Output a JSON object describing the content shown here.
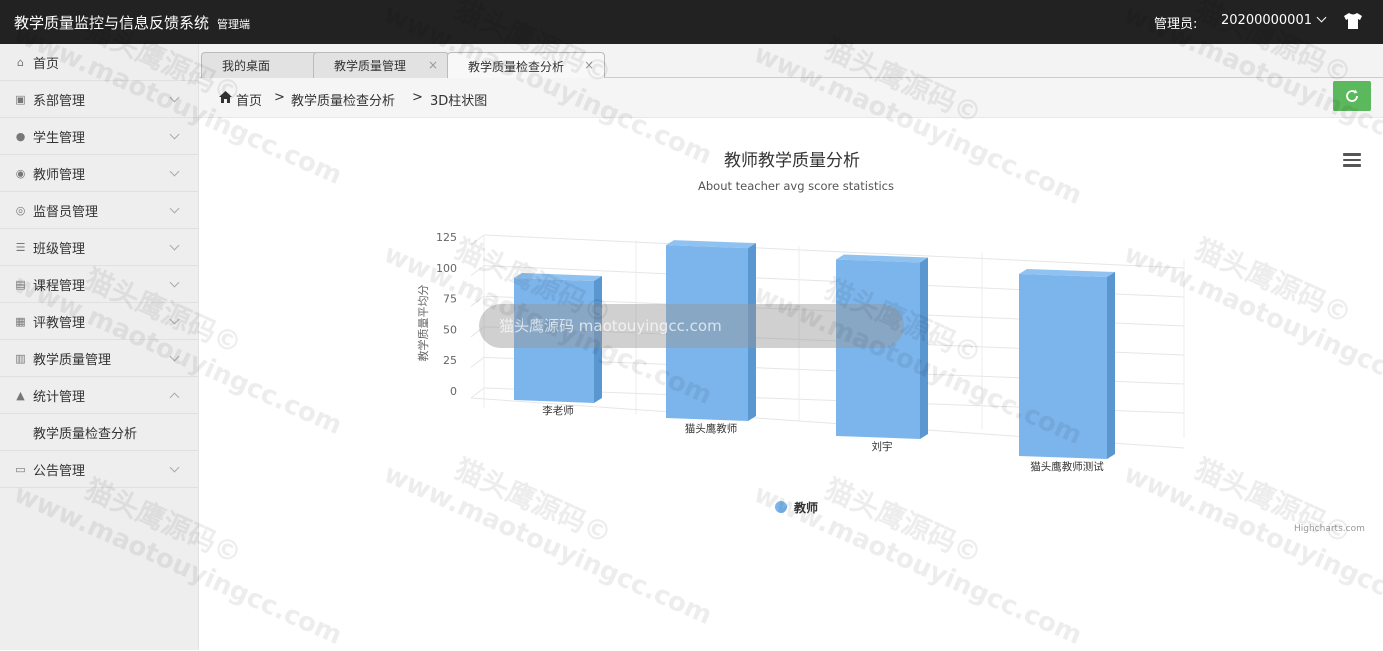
{
  "header": {
    "app_title": "教学质量监控与信息反馈系统",
    "app_subtitle": "管理端",
    "admin_label": "管理员:",
    "admin_id": "20200000001"
  },
  "sidebar": {
    "items": [
      {
        "label": "首页",
        "icon": "home-icon"
      },
      {
        "label": "系部管理",
        "icon": "building-icon"
      },
      {
        "label": "学生管理",
        "icon": "user-icon"
      },
      {
        "label": "教师管理",
        "icon": "user-circle-icon"
      },
      {
        "label": "监督员管理",
        "icon": "supervisor-icon"
      },
      {
        "label": "班级管理",
        "icon": "list-icon"
      },
      {
        "label": "课程管理",
        "icon": "book-icon"
      },
      {
        "label": "评教管理",
        "icon": "evaluate-icon"
      },
      {
        "label": "教学质量管理",
        "icon": "quality-icon"
      },
      {
        "label": "统计管理",
        "icon": "stats-icon",
        "expanded": true,
        "children": [
          "教学质量检查分析"
        ]
      },
      {
        "label": "公告管理",
        "icon": "notice-icon"
      }
    ]
  },
  "tabs": [
    {
      "label": "我的桌面"
    },
    {
      "label": "教学质量管理"
    },
    {
      "label": "教学质量检查分析",
      "active": true
    }
  ],
  "breadcrumb": [
    "首页",
    "教学质量检查分析",
    "3D柱状图"
  ],
  "breadcrumb_sep": ">",
  "tab_close": "×",
  "chart_data": {
    "type": "bar",
    "title": "教师教学质量分析",
    "subtitle": "About teacher avg score statistics",
    "ylabel": "教学质量平均分",
    "ylim": [
      0,
      125
    ],
    "yticks": [
      "125",
      "100",
      "75",
      "50",
      "25",
      "0"
    ],
    "categories": [
      "李老师",
      "猫头鹰教师",
      "刘宇",
      "猫头鹰教师测试"
    ],
    "series": [
      {
        "name": "教师",
        "values": [
          67,
          95,
          97,
          100
        ]
      }
    ],
    "color": "#7cb5ec",
    "legend": "bottom-center",
    "credits": "Highcharts.com"
  },
  "watermark": {
    "brand": "猫头鹰源码",
    "url": "www.maotouyingcc.com"
  },
  "overlay_text": "猫头鹰源码 maotouyingcc.com"
}
